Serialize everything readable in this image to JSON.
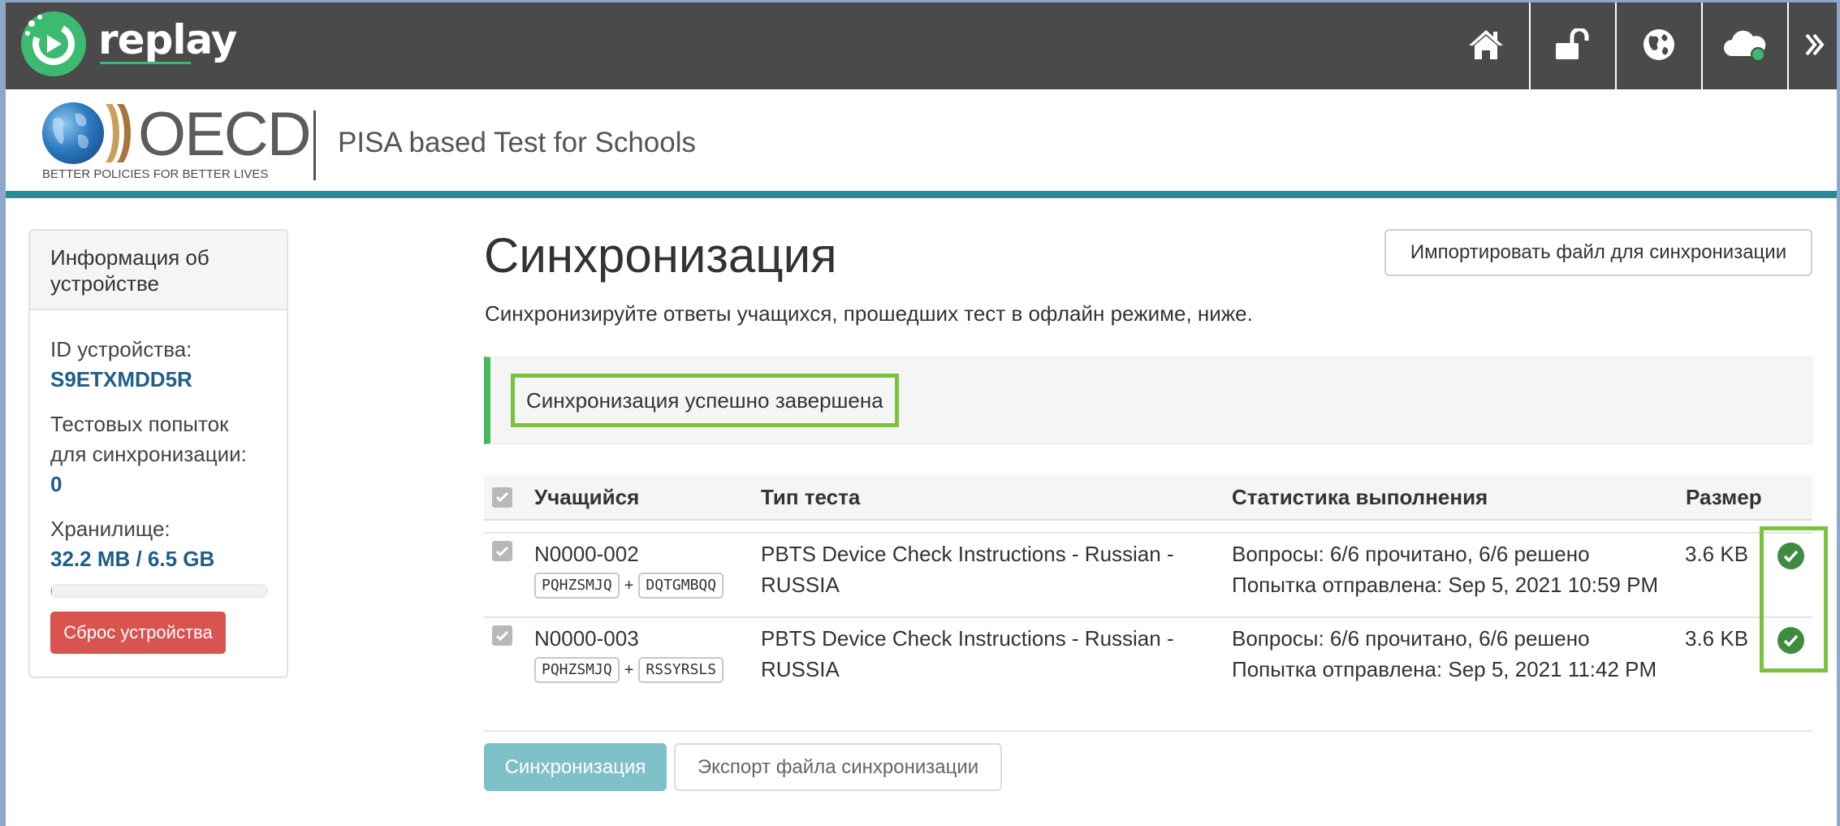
{
  "app": {
    "brand": "replay",
    "nav_icons": [
      "home-icon",
      "unlock-icon",
      "globe-icon",
      "cloud-sync-icon",
      "double-chevron-right-icon"
    ]
  },
  "header": {
    "org_name": "OECD",
    "org_tagline": "BETTER POLICIES FOR BETTER LIVES",
    "product_title": "PISA based Test for Schools"
  },
  "sidebar": {
    "title": "Информация об устройстве",
    "device_id_label": "ID устройства:",
    "device_id": "S9ETXMDD5R",
    "attempts_label": "Тестовых попыток для синхронизации:",
    "attempts_value": "0",
    "storage_label": "Хранилище:",
    "storage_value": "32.2 MB / 6.5 GB",
    "storage_fraction": 0.005,
    "reset_label": "Сброс устройства"
  },
  "main": {
    "title": "Синхронизация",
    "import_label": "Импортировать файл для синхронизации",
    "subtitle": "Синхронизируйте ответы учащихся, прошедших тест в офлайн режиме, ниже.",
    "alert": "Синхронизация успешно завершена",
    "table": {
      "headers": {
        "student": "Учащийся",
        "test_type": "Тип теста",
        "stats": "Статистика выполнения",
        "size": "Размер"
      },
      "rows": [
        {
          "student_id": "N0000-002",
          "code_a": "PQHZSMJQ",
          "code_b": "DQTGMBQQ",
          "test_line1": "PBTS Device Check Instructions - Russian -",
          "test_line2": "RUSSIA",
          "stats_line1": "Вопросы: 6/6 прочитано, 6/6 решено",
          "stats_line2": "Попытка отправлена: Sep 5, 2021 10:59 PM",
          "size": "3.6 KB"
        },
        {
          "student_id": "N0000-003",
          "code_a": "PQHZSMJQ",
          "code_b": "RSSYRSLS",
          "test_line1": "PBTS Device Check Instructions - Russian -",
          "test_line2": "RUSSIA",
          "stats_line1": "Вопросы: 6/6 прочитано, 6/6 решено",
          "stats_line2": "Попытка отправлена: Sep 5, 2021 11:42 PM",
          "size": "3.6 KB"
        }
      ]
    },
    "sync_label": "Синхронизация",
    "export_label": "Экспорт файла синхронизации"
  },
  "colors": {
    "nav_bg": "#4a4a4a",
    "accent_green": "#3cba6f",
    "highlight_green": "#7cc241",
    "teal_rule": "#2b8a9a",
    "danger": "#d9534f",
    "link_blue": "#1f5e88"
  }
}
